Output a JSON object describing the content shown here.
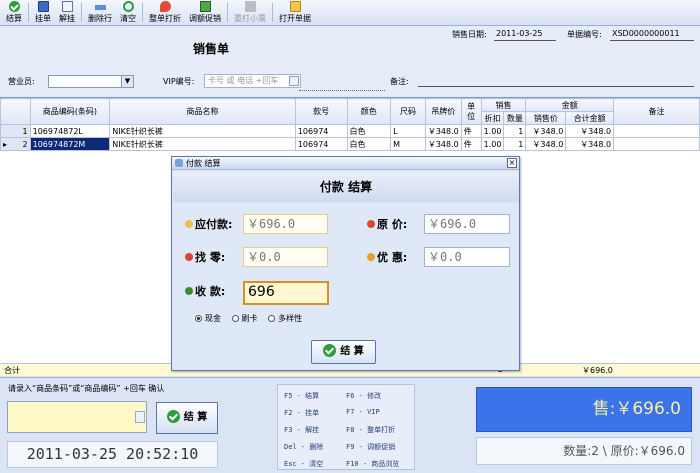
{
  "toolbar": {
    "items": [
      {
        "label": "结算",
        "icon": "check-icon"
      },
      {
        "label": "挂单",
        "icon": "save-icon"
      },
      {
        "label": "解挂",
        "icon": "document-icon"
      },
      {
        "label": "删除行",
        "icon": "delete-row-icon"
      },
      {
        "label": "清空",
        "icon": "refresh-icon"
      },
      {
        "label": "整单打折",
        "icon": "tag-icon"
      },
      {
        "label": "调额促销",
        "icon": "cube-icon"
      },
      {
        "label": "重打小票",
        "icon": "printer-icon",
        "disabled": true
      },
      {
        "label": "打开单据",
        "icon": "folder-icon"
      }
    ]
  },
  "header": {
    "title": "销售单",
    "sale_date_label": "销售日期:",
    "sale_date": "2011-03-25",
    "doc_no_label": "单据编号:",
    "doc_no": "XSD0000000011",
    "clerk_label": "营业员:",
    "clerk_value": "",
    "vip_label": "VIP编号:",
    "vip_placeholder": "卡号 或 电话 +回车",
    "remark_label": "备注:"
  },
  "table": {
    "headers": {
      "code": "商品编码(条码)",
      "name": "商品名称",
      "style": "款号",
      "color": "颜色",
      "size": "尺码",
      "tag_price": "吊牌价",
      "unit": "单位",
      "sale_group": "销售",
      "discount": "折扣",
      "qty": "数量",
      "amount_group": "金额",
      "sale_price": "销售价",
      "total": "合计金额",
      "remark": "备注"
    },
    "rows": [
      {
        "no": "1",
        "code": "106974872L",
        "name": "NIKE针织长裤",
        "style": "106974",
        "color": "白色",
        "size": "L",
        "tag_price": "￥348.0",
        "unit": "件",
        "discount": "1.00",
        "qty": "1",
        "sale_price": "￥348.0",
        "total": "￥348.0"
      },
      {
        "no": "2",
        "code": "106974872M",
        "name": "NIKE针织长裤",
        "style": "106974",
        "color": "白色",
        "size": "M",
        "tag_price": "￥348.0",
        "unit": "件",
        "discount": "1.00",
        "qty": "1",
        "sale_price": "￥348.0",
        "total": "￥348.0"
      }
    ],
    "selected_row": 2,
    "summary_label": "合计",
    "summary_qty": "2",
    "summary_total": "￥696.0"
  },
  "dialog": {
    "window_title": "付款 结算",
    "heading": "付款  结算",
    "payable_label": "应付款:",
    "payable_value": "￥696.0",
    "original_label": "原  价:",
    "original_value": "￥696.0",
    "change_label": "找  零:",
    "change_value": "￥0.0",
    "discount_label": "优  惠:",
    "discount_value": "￥0.0",
    "received_label": "收  款:",
    "received_value": "696",
    "pay_methods": [
      "现金",
      "刷卡",
      "多样性"
    ],
    "selected_method": "现金",
    "settle_button": "结  算"
  },
  "bottom": {
    "hint": "请录入“商品条码”或“商品编码” +回车 确认",
    "settle_button": "结 算",
    "datetime": "2011-03-25 20:52:10",
    "shortcuts": [
      "F5 - 结算",
      "F6 - 修改",
      "F2 - 挂单",
      "F7 - VIP",
      "F3 - 解挂",
      "F8 - 整单打折",
      "Del - 删除",
      "F9 - 调额促销",
      "Esc - 清空",
      "F10 - 商品浏览"
    ],
    "sale_total": "售:￥696.0",
    "summary": "数量:2 \\ 原价:￥696.0"
  },
  "colors": {
    "selection": "#0c2a78",
    "total_box_bg": "#3b73ea",
    "total_box_text": "#f6f1a0",
    "received_border": "#d4902c"
  }
}
